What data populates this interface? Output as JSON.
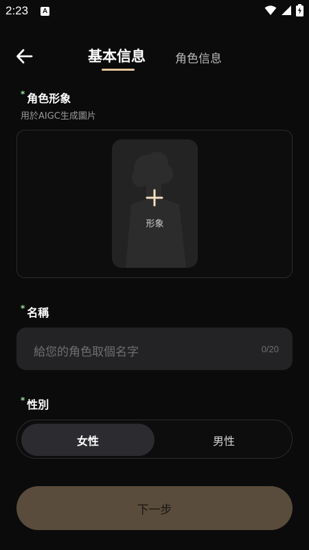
{
  "status_bar": {
    "time": "2:23",
    "a_icon": "A"
  },
  "tabs": [
    {
      "label": "基本信息",
      "active": true
    },
    {
      "label": "角色信息",
      "active": false
    }
  ],
  "appearance": {
    "label": "角色形象",
    "sublabel": "用於AIGC生成圖片",
    "card_label": "形象"
  },
  "name": {
    "label": "名稱",
    "placeholder": "給您的角色取個名字",
    "counter": "0/20"
  },
  "gender": {
    "label": "性別",
    "options": [
      "女性",
      "男性"
    ],
    "selected": "女性"
  },
  "next_button": {
    "label": "下一步"
  },
  "colors": {
    "background": "#0b0b0b",
    "accent": "#e6c79c",
    "required_mark": "#9ee29e",
    "next_button": "#5a4c3c"
  }
}
